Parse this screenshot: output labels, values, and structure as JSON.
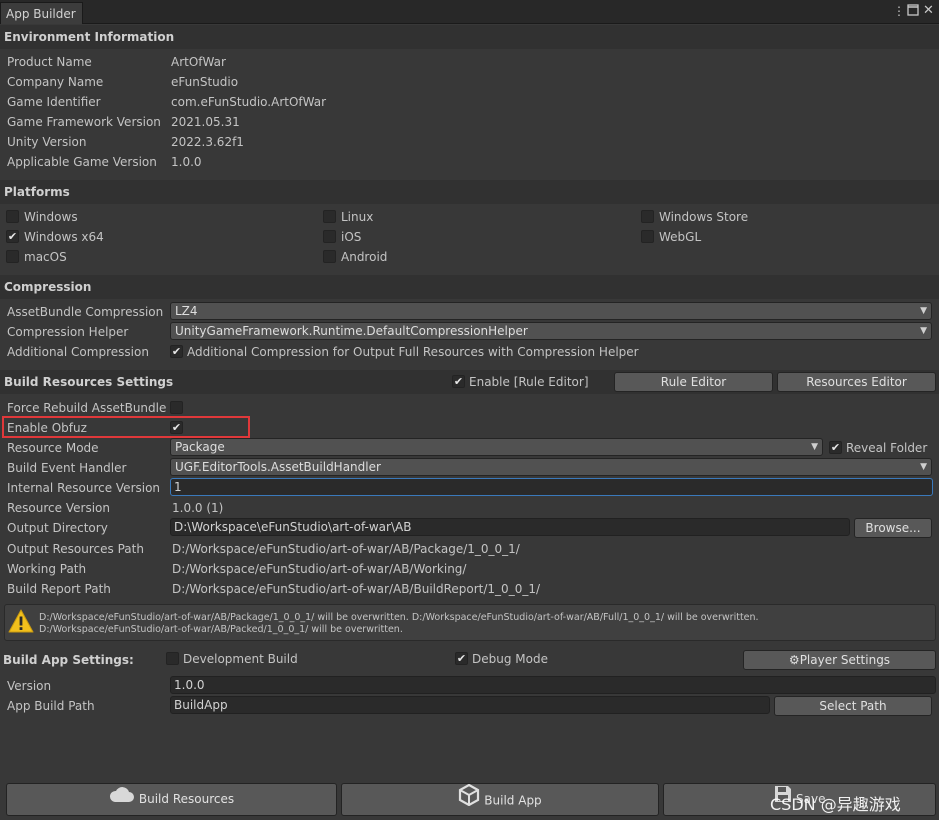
{
  "window": {
    "tab_title": "App Builder",
    "menu_icon": "kebab-menu-icon",
    "maximize_icon": "maximize-icon",
    "close_icon": "close-icon"
  },
  "environment": {
    "header": "Environment Information",
    "rows": [
      {
        "label": "Product Name",
        "value": "ArtOfWar"
      },
      {
        "label": "Company Name",
        "value": "eFunStudio"
      },
      {
        "label": "Game Identifier",
        "value": "com.eFunStudio.ArtOfWar"
      },
      {
        "label": "Game Framework Version",
        "value": "2021.05.31"
      },
      {
        "label": "Unity Version",
        "value": "2022.3.62f1"
      },
      {
        "label": "Applicable Game Version",
        "value": "1.0.0"
      }
    ]
  },
  "platforms": {
    "header": "Platforms",
    "items": [
      {
        "label": "Windows",
        "checked": false
      },
      {
        "label": "Windows x64",
        "checked": true
      },
      {
        "label": "macOS",
        "checked": false
      },
      {
        "label": "Linux",
        "checked": false
      },
      {
        "label": "iOS",
        "checked": false
      },
      {
        "label": "Android",
        "checked": false
      },
      {
        "label": "Windows Store",
        "checked": false
      },
      {
        "label": "WebGL",
        "checked": false
      }
    ]
  },
  "compression": {
    "header": "Compression",
    "assetbundle_label": "AssetBundle Compression",
    "assetbundle_value": "LZ4",
    "helper_label": "Compression Helper",
    "helper_value": "UnityGameFramework.Runtime.DefaultCompressionHelper",
    "additional_label": "Additional Compression",
    "additional_text": "Additional Compression for Output Full Resources with Compression Helper",
    "additional_checked": true
  },
  "build_resources": {
    "header": "Build Resources Settings",
    "enable_rule_editor": "Enable [Rule Editor]",
    "rule_editor_button": "Rule Editor",
    "resources_editor_button": "Resources Editor",
    "force_rebuild_label": "Force Rebuild AssetBundle",
    "enable_obfuz_label": "Enable Obfuz",
    "resource_mode_label": "Resource Mode",
    "resource_mode_value": "Package",
    "reveal_folder": "Reveal Folder",
    "build_event_label": "Build Event Handler",
    "build_event_value": "UGF.EditorTools.AssetBuildHandler",
    "internal_version_label": "Internal Resource Version",
    "internal_version_value": "1",
    "resource_version_label": "Resource Version",
    "resource_version_value": "1.0.0 (1)",
    "output_dir_label": "Output Directory",
    "output_dir_value": "D:\\Workspace\\eFunStudio\\art-of-war\\AB",
    "browse_button": "Browse...",
    "output_res_label": "Output Resources Path",
    "output_res_value": "D:/Workspace/eFunStudio/art-of-war/AB/Package/1_0_0_1/",
    "working_label": "Working Path",
    "working_value": "D:/Workspace/eFunStudio/art-of-war/AB/Working/",
    "report_label": "Build Report Path",
    "report_value": "D:/Workspace/eFunStudio/art-of-war/AB/BuildReport/1_0_0_1/",
    "warning_line1": "D:/Workspace/eFunStudio/art-of-war/AB/Package/1_0_0_1/ will be overwritten. D:/Workspace/eFunStudio/art-of-war/AB/Full/1_0_0_1/ will be overwritten.",
    "warning_line2": "D:/Workspace/eFunStudio/art-of-war/AB/Packed/1_0_0_1/ will be overwritten."
  },
  "build_app": {
    "header": "Build App Settings:",
    "development_build": "Development Build",
    "debug_mode": "Debug Mode",
    "player_settings_button": "Player Settings",
    "version_label": "Version",
    "version_value": "1.0.0",
    "path_label": "App Build Path",
    "path_value": "BuildApp",
    "select_path_button": "Select Path"
  },
  "bottom": {
    "build_resources_button": "Build Resources",
    "build_app_button": "Build App",
    "save_button": "Save"
  },
  "watermark": "CSDN @异趣游戏",
  "colors": {
    "background": "#383838",
    "header_background": "#313131",
    "highlight_border": "#e0383a",
    "focus_border": "#3a79bb",
    "warning_yellow": "#f2c01c"
  }
}
